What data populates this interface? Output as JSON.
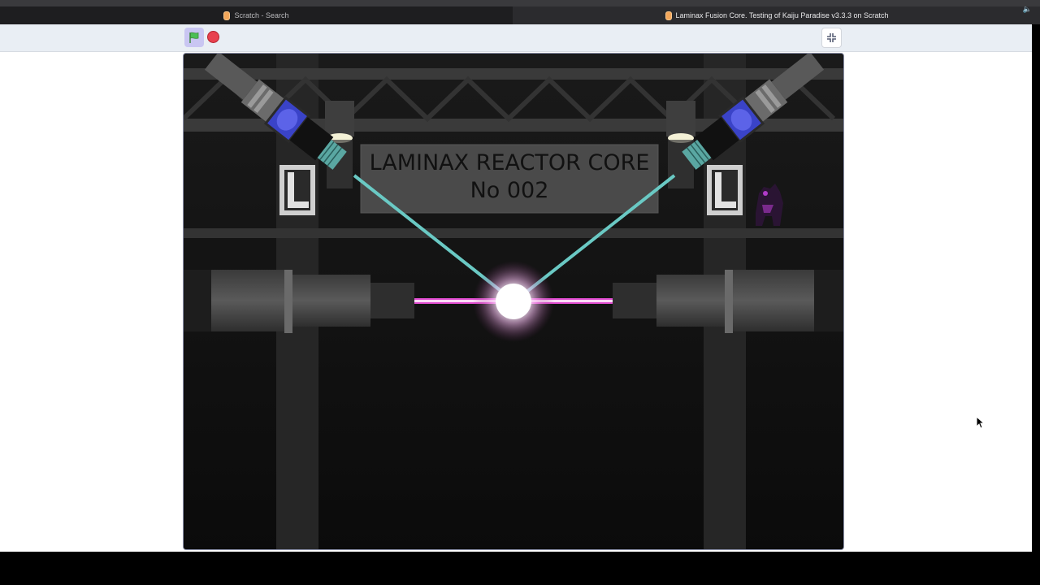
{
  "browser": {
    "tabs": [
      {
        "title": "Scratch - Search",
        "active": false
      },
      {
        "title": "Laminax Fusion Core. Testing of Kaiju Paradise v3.3.3 on Scratch",
        "active": true
      }
    ],
    "speaker_icon": "speaker-icon"
  },
  "player": {
    "green_flag_icon": "green-flag-icon",
    "stop_icon": "stop-sign-icon",
    "fullscreen_icon": "exit-fullscreen-icon"
  },
  "stage": {
    "sign_line1": "LAMINAX REACTOR CORE",
    "sign_line2": "No 002",
    "colors": {
      "background": "#141414",
      "beam_cyan": "#6ac9c4",
      "beam_magenta": "#e04bd0",
      "core_glow": "#ffffff",
      "pillar": "#2a2a2a",
      "sign": "#4a4a4a"
    }
  }
}
